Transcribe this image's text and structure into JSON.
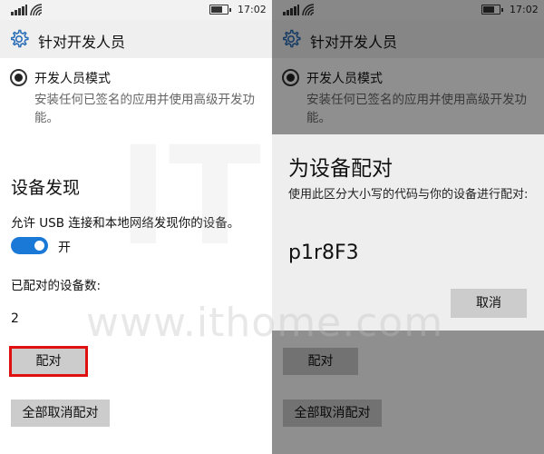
{
  "status_bar": {
    "time": "17:02"
  },
  "header": {
    "title": "针对开发人员",
    "icon": "gear-icon"
  },
  "developer_mode": {
    "label": "开发人员模式",
    "description": "安装任何已签名的应用并使用高级开发功能。",
    "selected": true
  },
  "device_discovery": {
    "title": "设备发现",
    "toggle_label": "允许 USB 连接和本地网络发现你的设备。",
    "toggle_state": "开",
    "toggle_on": true,
    "toggle_color": "#1a78d6",
    "paired_count_label": "已配对的设备数:",
    "paired_count": "2",
    "pair_button": "配对",
    "unpair_all_button": "全部取消配对",
    "highlight_color": "#e01010"
  },
  "pair_dialog": {
    "title": "为设备配对",
    "description": "使用此区分大小写的代码与你的设备进行配对:",
    "code": "p1r8F3",
    "cancel_button": "取消"
  },
  "watermark": {
    "text": "www.ithome.com",
    "logo_text": "IT"
  }
}
